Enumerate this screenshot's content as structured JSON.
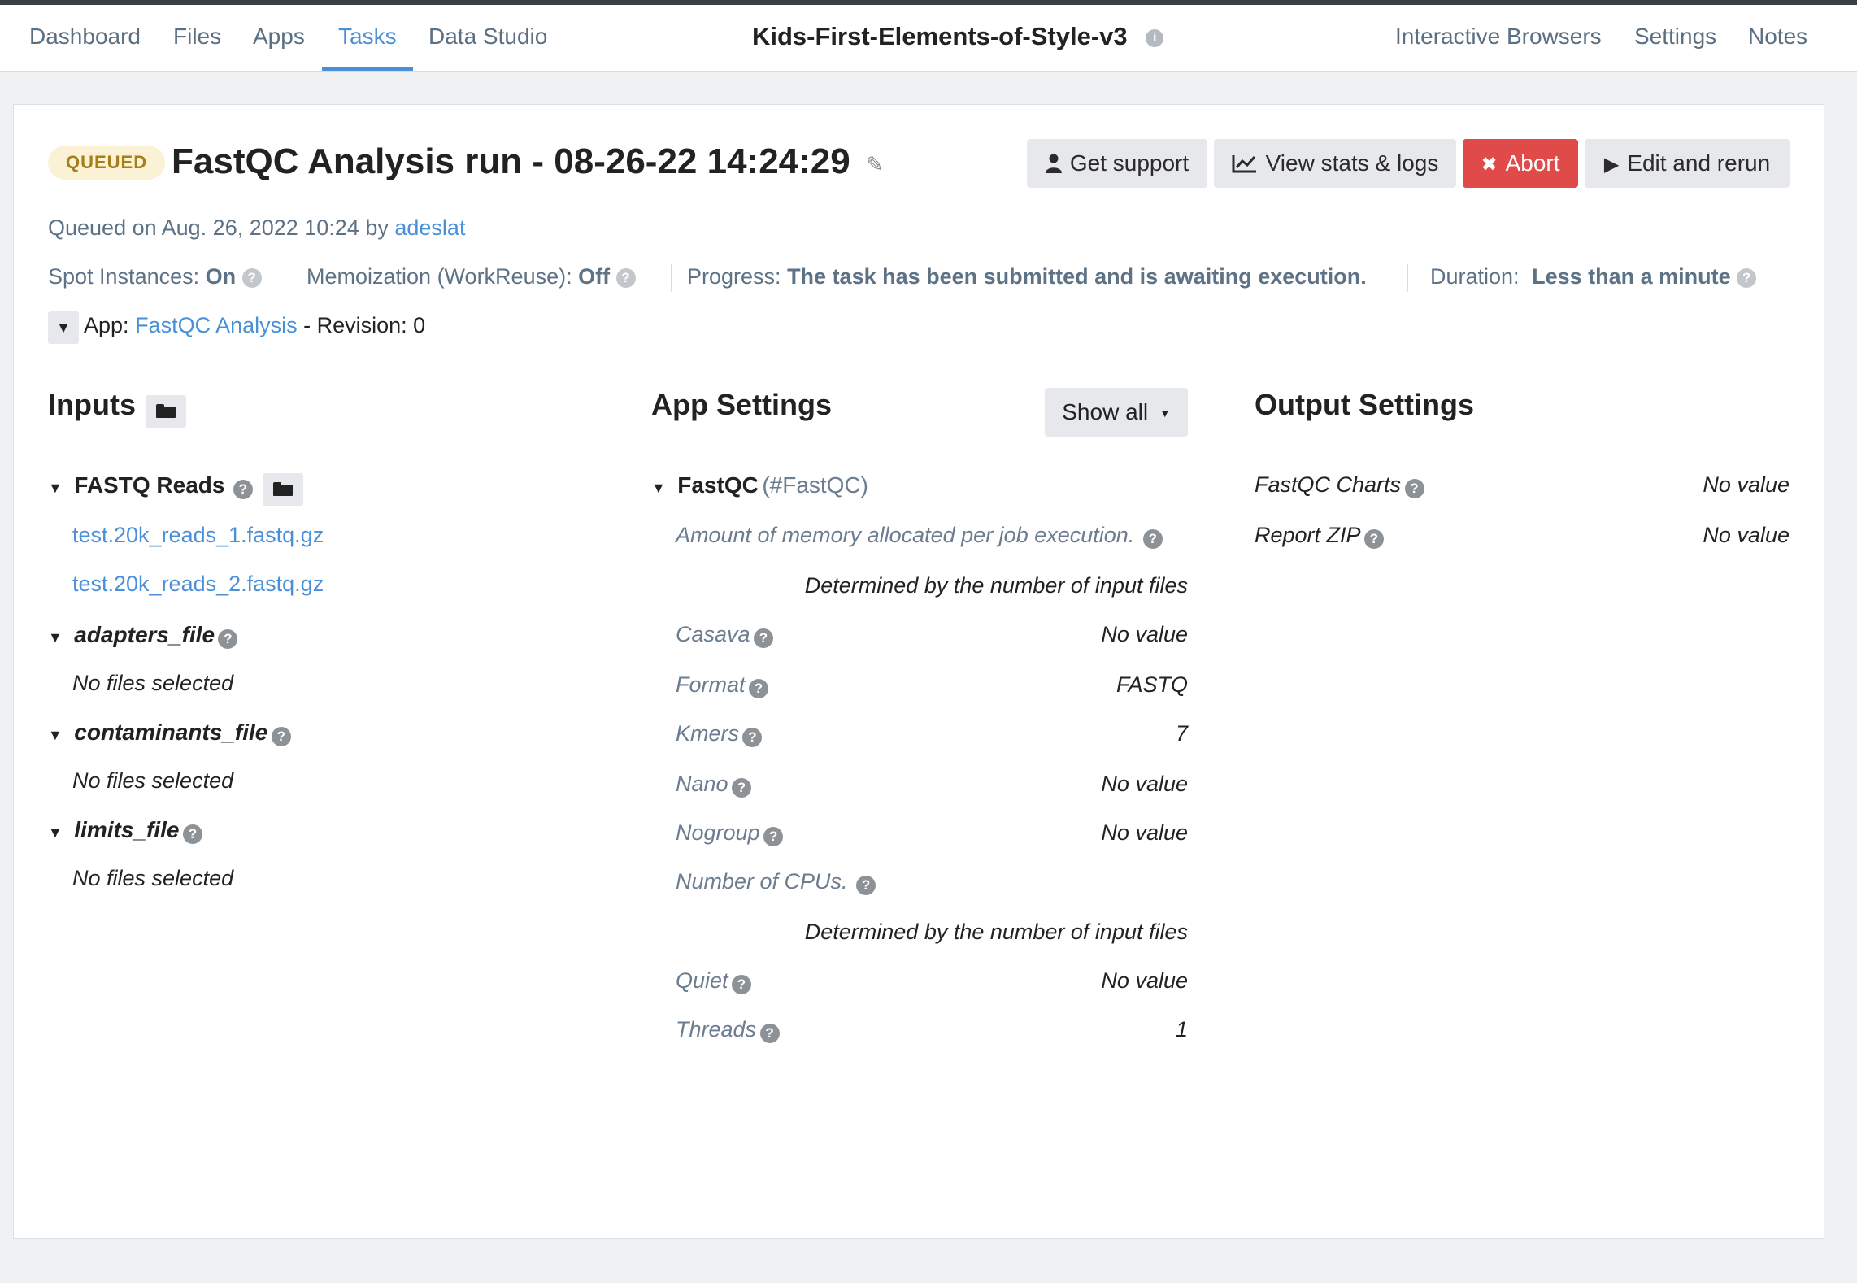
{
  "nav": {
    "left": [
      "Dashboard",
      "Files",
      "Apps",
      "Tasks",
      "Data Studio"
    ],
    "active": "Tasks",
    "project_title": "Kids-First-Elements-of-Style-v3",
    "right": [
      "Interactive Browsers",
      "Settings",
      "Notes"
    ]
  },
  "task": {
    "status": "QUEUED",
    "title": "FastQC Analysis run - 08-26-22 14:24:29",
    "queued_prefix": "Queued on Aug. 26, 2022 10:24 by",
    "queued_user": "adeslat",
    "spot_label": "Spot Instances:",
    "spot_value": "On",
    "memo_label": "Memoization (WorkReuse):",
    "memo_value": "Off",
    "progress_label": "Progress:",
    "progress_value": "The task has been submitted and is awaiting execution.",
    "duration_label": "Duration:",
    "duration_value": "Less than a minute",
    "app_label": "App:",
    "app_name": "FastQC Analysis",
    "revision_text": "- Revision: 0"
  },
  "buttons": {
    "support": "Get support",
    "stats": "View stats & logs",
    "abort": "Abort",
    "rerun": "Edit and rerun"
  },
  "inputs": {
    "heading": "Inputs",
    "fastq": {
      "name": "FASTQ Reads",
      "files": [
        "test.20k_reads_1.fastq.gz",
        "test.20k_reads_2.fastq.gz"
      ]
    },
    "adapters": {
      "name": "adapters_file",
      "note": "No files selected"
    },
    "contaminants": {
      "name": "contaminants_file",
      "note": "No files selected"
    },
    "limits": {
      "name": "limits_file",
      "note": "No files selected"
    }
  },
  "app_settings": {
    "heading": "App Settings",
    "show_all": "Show all",
    "tool_name": "FastQC",
    "tool_id": "(#FastQC)",
    "memory_label": "Amount of memory allocated per job execution.",
    "memory_value": "Determined by the number of input files",
    "rows": [
      {
        "label": "Casava",
        "value": "No value"
      },
      {
        "label": "Format",
        "value": "FASTQ"
      },
      {
        "label": "Kmers",
        "value": "7"
      },
      {
        "label": "Nano",
        "value": "No value"
      },
      {
        "label": "Nogroup",
        "value": "No value"
      }
    ],
    "cpus_label": "Number of CPUs.",
    "cpus_value": "Determined by the number of input files",
    "rows2": [
      {
        "label": "Quiet",
        "value": "No value"
      },
      {
        "label": "Threads",
        "value": "1"
      }
    ]
  },
  "output_settings": {
    "heading": "Output Settings",
    "rows": [
      {
        "label": "FastQC Charts",
        "value": "No value"
      },
      {
        "label": "Report ZIP",
        "value": "No value"
      }
    ]
  }
}
